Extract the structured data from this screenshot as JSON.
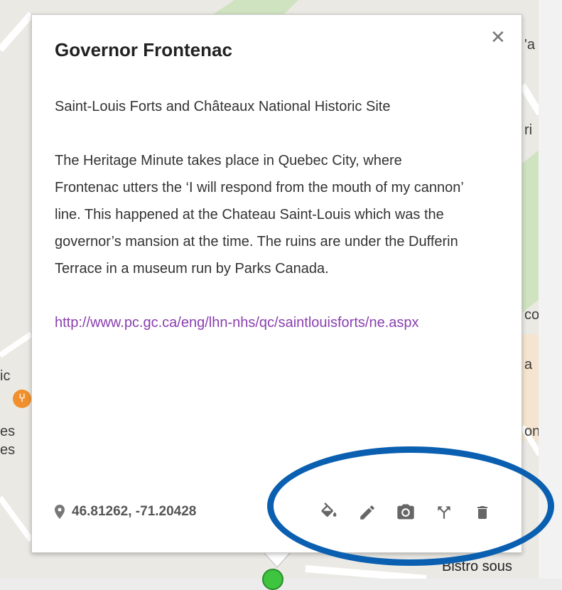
{
  "popup": {
    "title": "Governor Frontenac",
    "site": "Saint-Louis Forts and Châteaux National Historic Site",
    "description": "The Heritage Minute takes place in Quebec City, where Frontenac utters the ‘I will respond from the mouth of my cannon’ line. This happened at the Chateau Saint-Louis which was the governor’s mansion at the time. The ruins are under the Dufferin Terrace in a museum run by Parks Canada.",
    "link": "http://www.pc.gc.ca/eng/lhn-nhs/qc/saintlouisforts/ne.aspx",
    "coordinates": "46.81262, -71.20428",
    "close_icon": "close-icon",
    "tools": [
      {
        "name": "paint-bucket-icon"
      },
      {
        "name": "pencil-icon"
      },
      {
        "name": "camera-icon"
      },
      {
        "name": "directions-icon"
      },
      {
        "name": "trash-icon"
      }
    ]
  },
  "map": {
    "labels": {
      "l1": "'a",
      "l2": "ri",
      "l3": "co",
      "l4": "a",
      "l5": "ic",
      "l6": "es",
      "l7": "es",
      "l8": "on",
      "l9": "Bistro sous"
    },
    "poi_icon": "restaurant-icon"
  },
  "colors": {
    "highlight": "#0a5fb0",
    "link": "#8a3fb0",
    "poi": "#f0902c",
    "marker": "#3ec43e"
  }
}
